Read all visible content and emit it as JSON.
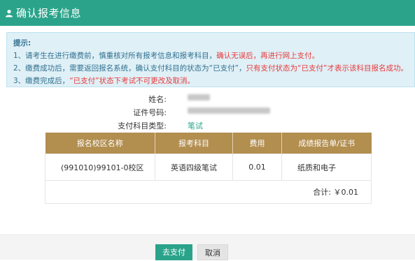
{
  "dialog": {
    "title": "确认报考信息",
    "title_icon": "user-icon"
  },
  "notice": {
    "heading": "提示:",
    "line1_prefix": "1、请考生在进行缴费前，慎重核对所有报考信息和报考科目，",
    "line1_highlight": "确认无误后，再进行网上支付。",
    "line2_prefix": "2、缴费成功后，需要返回报名系统，确认支付科目的状态为“已支付”，",
    "line2_highlight": "只有支付状态为“已支付”才表示该科目报名成功。",
    "line3_prefix": "3、缴费完成后，",
    "line3_highlight": "“已支付”状态下考试不可更改及取消。"
  },
  "info": {
    "name_label": "姓名:",
    "id_label": "证件号码:",
    "subject_type_label": "支付科目类型:",
    "subject_type_value": "笔试"
  },
  "table": {
    "headers": [
      "报名校区名称",
      "报考科目",
      "费用",
      "成绩报告单/证书"
    ],
    "rows": [
      [
        "(991010)99101-0校区",
        "英语四级笔试",
        "0.01",
        "纸质和电子"
      ]
    ],
    "total": "合计: ￥0.01"
  },
  "footer": {
    "pay_button": "去支付",
    "cancel_button": "取消"
  },
  "colors": {
    "accent": "#2aa38a",
    "table_header": "#b28e4f",
    "warning": "#e83a3a",
    "notice_bg": "#dff0f7"
  }
}
